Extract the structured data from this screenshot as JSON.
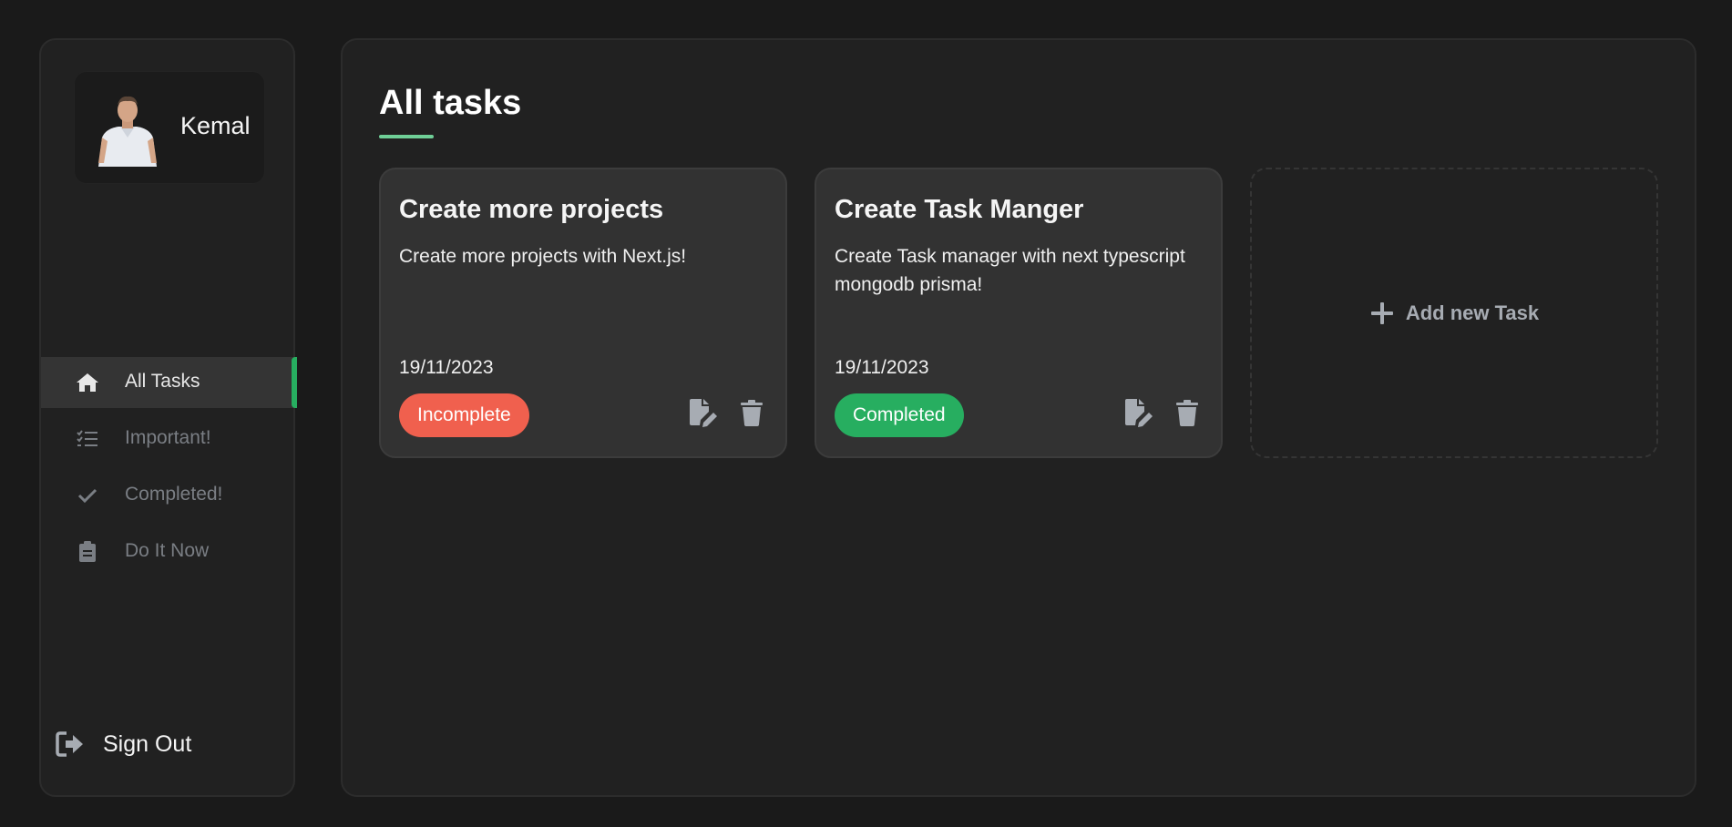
{
  "sidebar": {
    "user": {
      "name": "Kemal"
    },
    "items": [
      {
        "label": "All Tasks",
        "icon": "home-icon",
        "active": true
      },
      {
        "label": "Important!",
        "icon": "list-check-icon",
        "active": false
      },
      {
        "label": "Completed!",
        "icon": "check-icon",
        "active": false
      },
      {
        "label": "Do It Now",
        "icon": "clipboard-icon",
        "active": false
      }
    ],
    "signout_label": "Sign Out"
  },
  "main": {
    "title": "All tasks",
    "tasks": [
      {
        "title": "Create more projects",
        "description": "Create more projects with Next.js!",
        "date": "19/11/2023",
        "status": "Incomplete"
      },
      {
        "title": "Create Task Manger",
        "description": "Create Task manager with next typescript mongodb prisma!",
        "date": "19/11/2023",
        "status": "Completed"
      }
    ],
    "add_task_label": "Add new Task"
  },
  "colors": {
    "accent_green": "#27ae60",
    "incomplete_red": "#f0604e",
    "underline": "#6fcf97"
  }
}
